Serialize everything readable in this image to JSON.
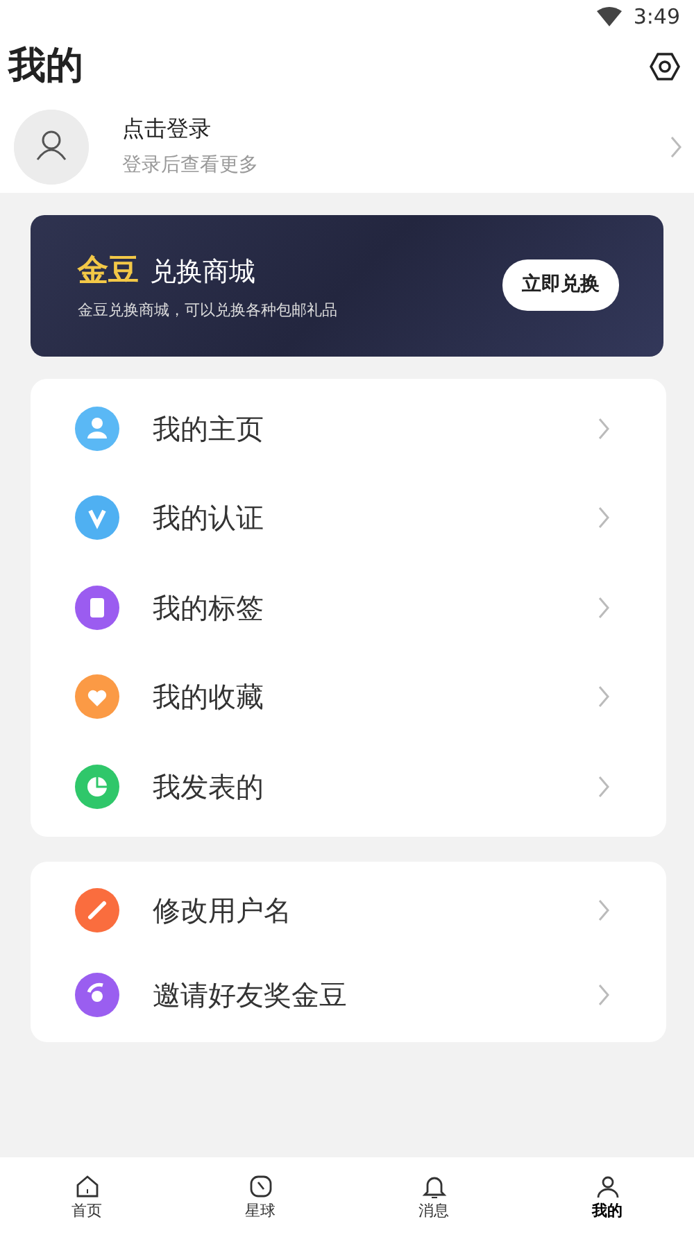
{
  "status_bar": {
    "time": "3:49"
  },
  "header": {
    "title": "我的"
  },
  "login": {
    "title": "点击登录",
    "subtitle": "登录后查看更多"
  },
  "banner": {
    "highlight": "金豆",
    "title": "兑换商城",
    "description": "金豆兑换商城，可以兑换各种包邮礼品",
    "button": "立即兑换"
  },
  "menu_groups": [
    [
      {
        "label": "我的主页",
        "color": "#5ab8f5"
      },
      {
        "label": "我的认证",
        "color": "#4fb0f2"
      },
      {
        "label": "我的标签",
        "color": "#9b5cf0"
      },
      {
        "label": "我的收藏",
        "color": "#fb9a45"
      },
      {
        "label": "我发表的",
        "color": "#2fc76a"
      }
    ],
    [
      {
        "label": "修改用户名",
        "color": "#fa6d3e"
      },
      {
        "label": "邀请好友奖金豆",
        "color": "#9a5ef0"
      }
    ]
  ],
  "tabs": [
    {
      "label": "首页",
      "selected": false
    },
    {
      "label": "星球",
      "selected": false
    },
    {
      "label": "消息",
      "selected": false
    },
    {
      "label": "我的",
      "selected": true
    }
  ]
}
